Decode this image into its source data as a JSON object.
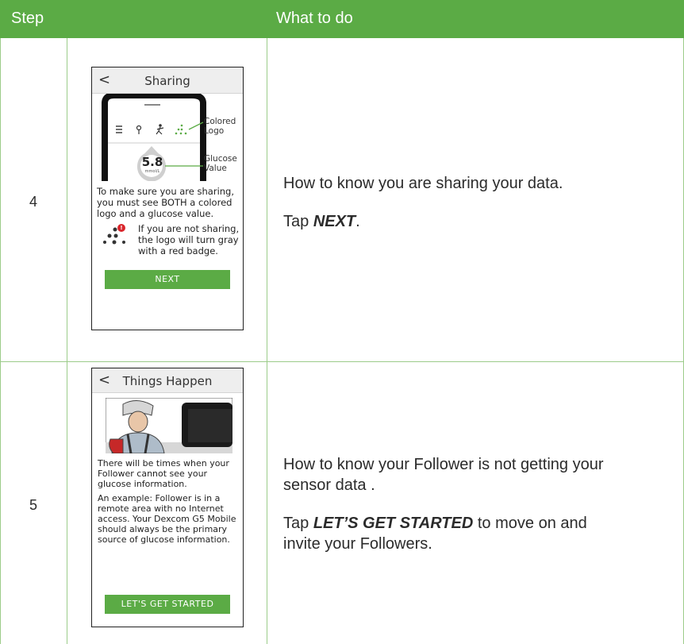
{
  "header": {
    "step": "Step",
    "what": "What to do"
  },
  "rows": [
    {
      "step": "4",
      "screen": {
        "back_glyph": "<",
        "title": "Sharing",
        "colored_logo": "Colored\nLogo",
        "glucose_value": "5.8",
        "glucose_unit": "mmol/L",
        "glucose_label": "Glucose\nValue",
        "instruction": "To make sure you are sharing,\nyou must see BOTH a colored\nlogo and a glucose value.",
        "not_sharing": "If you are not sharing,\nthe logo will turn gray\nwith a red badge.",
        "badge": "!",
        "button": "NEXT"
      },
      "desc_line1": "How to know you are sharing your data.",
      "tap_prefix": "Tap ",
      "tap_action": "NEXT",
      "tap_suffix": "."
    },
    {
      "step": "5",
      "screen": {
        "back_glyph": "<",
        "title": "Things Happen",
        "para1": "There will be times when your\nFollower cannot see your\nglucose information.",
        "para2": "An example: Follower is in a\nremote area with no Internet\naccess. Your Dexcom G5 Mobile\nshould always be the primary\nsource of glucose information.",
        "button": "LET'S GET STARTED"
      },
      "desc_line1": "How to know your Follower is not getting your\nsensor data .",
      "tap_prefix": "Tap ",
      "tap_action": "LET’S GET STARTED",
      "tap_suffix": " to move on and\ninvite your Followers."
    }
  ],
  "colors": {
    "header_green": "#5bab45",
    "grid": "#9ccc8a",
    "badge_red": "#d9262c"
  }
}
